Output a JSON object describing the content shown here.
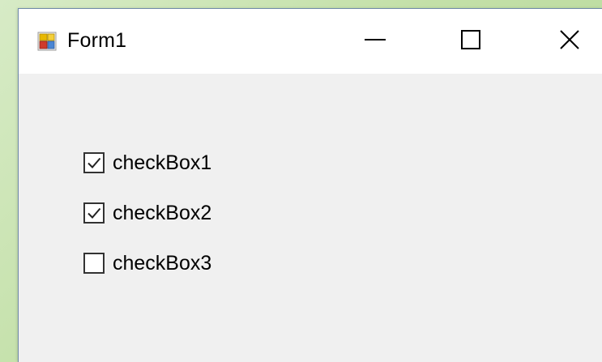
{
  "window": {
    "title": "Form1",
    "app_icon": "winforms-app-icon",
    "controls": {
      "minimize_icon": "minimize-icon",
      "maximize_icon": "maximize-icon",
      "close_icon": "close-icon"
    }
  },
  "checkboxes": [
    {
      "label": "checkBox1",
      "checked": true
    },
    {
      "label": "checkBox2",
      "checked": true
    },
    {
      "label": "checkBox3",
      "checked": false
    }
  ],
  "colors": {
    "desktop": "#c3e0a8",
    "client": "#f0f0f0",
    "titlebar": "#ffffff"
  }
}
